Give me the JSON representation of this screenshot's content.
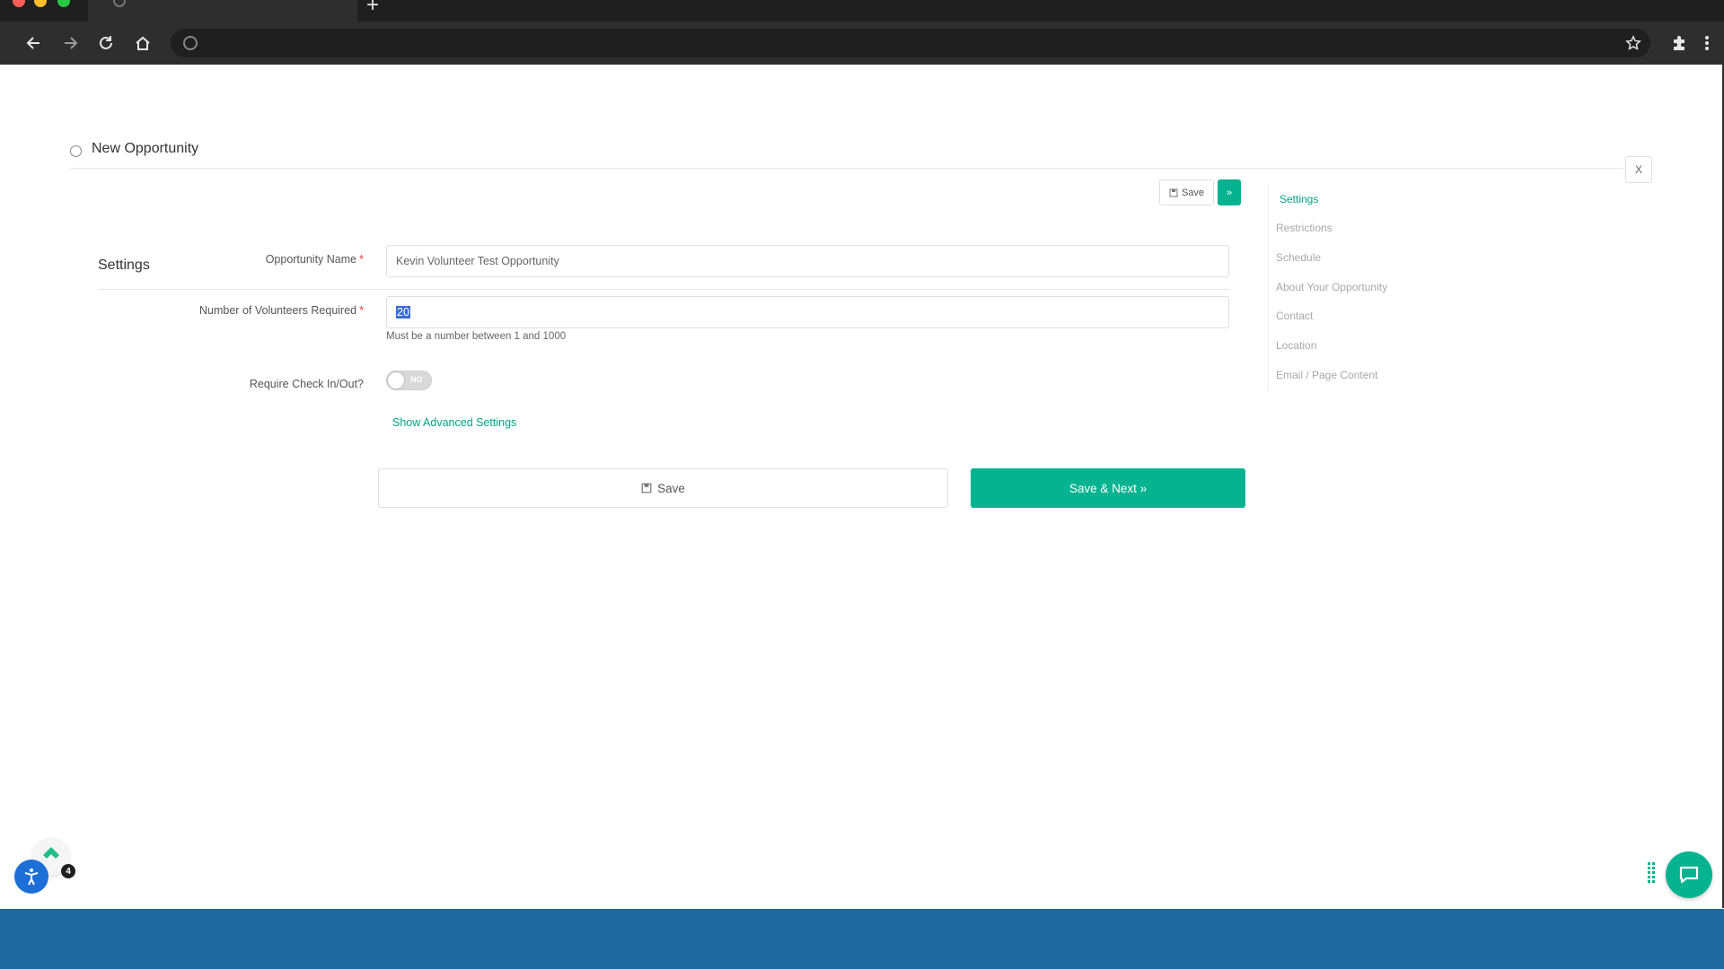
{
  "browser": {
    "new_tab_label": "+"
  },
  "header": {
    "title": "New Opportunity",
    "close_label": "X"
  },
  "section": {
    "title": "Settings",
    "mini_save_label": "Save",
    "mini_next_label": "»"
  },
  "form": {
    "opportunity_name": {
      "label": "Opportunity Name",
      "required_mark": "*",
      "value": "Kevin Volunteer Test Opportunity"
    },
    "volunteers_required": {
      "label": "Number of Volunteers Required",
      "required_mark": "*",
      "value": "20",
      "hint": "Must be a number between 1 and 1000"
    },
    "check_in_out": {
      "label": "Require Check In/Out?",
      "toggle_text": "NO"
    },
    "advanced_link": "Show Advanced Settings"
  },
  "actions": {
    "save_label": "Save",
    "save_next_label": "Save & Next »"
  },
  "side_nav": {
    "items": [
      {
        "label": "Settings",
        "active": true
      },
      {
        "label": "Restrictions",
        "active": false
      },
      {
        "label": "Schedule",
        "active": false
      },
      {
        "label": "About Your Opportunity",
        "active": false
      },
      {
        "label": "Contact",
        "active": false
      },
      {
        "label": "Location",
        "active": false
      },
      {
        "label": "Email / Page Content",
        "active": false
      }
    ]
  },
  "widgets": {
    "accessibility_badge": "4"
  },
  "colors": {
    "accent": "#06b390",
    "footer": "#20699f",
    "accessibility": "#1d6fd8"
  },
  "icons": {
    "back": "arrow-left-icon",
    "forward": "arrow-right-icon",
    "reload": "reload-icon",
    "home": "home-icon",
    "bookmark": "star-icon",
    "extensions": "puzzle-icon",
    "menu": "kebab-menu-icon",
    "chat": "chat-bubble-icon",
    "accessibility": "accessibility-icon"
  }
}
